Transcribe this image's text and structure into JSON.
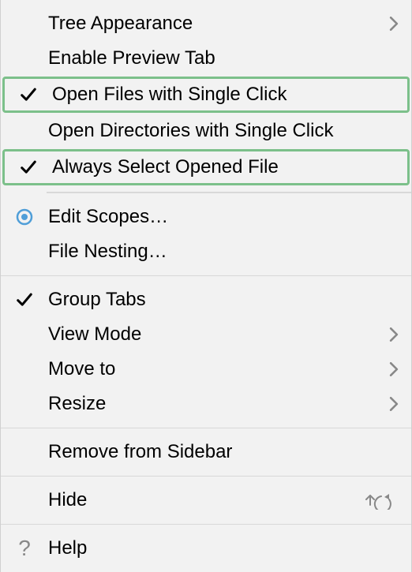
{
  "menu": {
    "items": [
      {
        "label": "Tree Appearance",
        "submenu": true
      },
      {
        "label": "Enable Preview Tab"
      },
      {
        "label": "Open Files with Single Click",
        "checked": true,
        "highlighted": true
      },
      {
        "label": "Open Directories with Single Click"
      },
      {
        "label": "Always Select Opened File",
        "checked": true,
        "highlighted": true
      },
      {
        "label": "Edit Scopes…",
        "radio": true
      },
      {
        "label": "File Nesting…"
      },
      {
        "label": "Group Tabs",
        "checked": true
      },
      {
        "label": "View Mode",
        "submenu": true
      },
      {
        "label": "Move to",
        "submenu": true
      },
      {
        "label": "Resize",
        "submenu": true
      },
      {
        "label": "Remove from Sidebar"
      },
      {
        "label": "Hide",
        "shortcut": true
      },
      {
        "label": "Help",
        "help": true
      }
    ]
  }
}
